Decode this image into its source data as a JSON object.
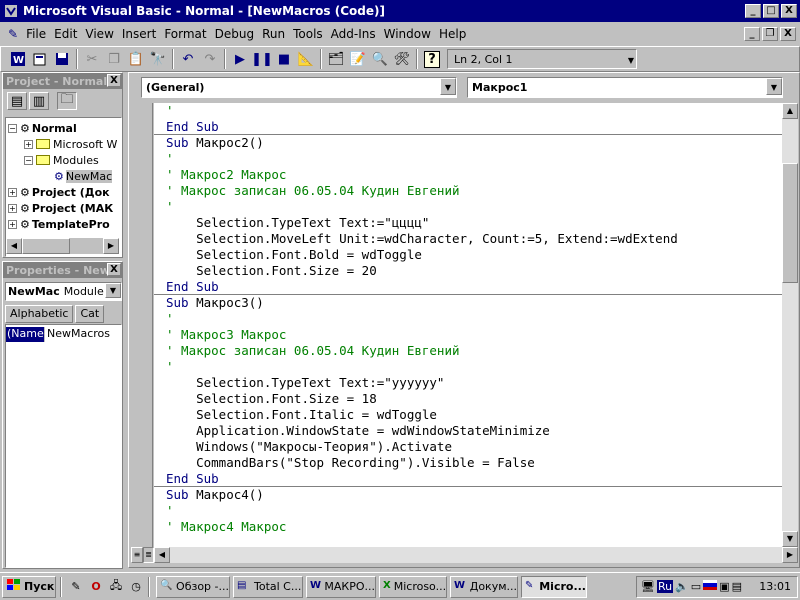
{
  "window": {
    "title": "Microsoft Visual Basic - Normal - [NewMacros (Code)]",
    "min": "_",
    "max": "□",
    "close": "X",
    "inner_min": "_",
    "inner_restore": "❐",
    "inner_close": "X"
  },
  "menu": [
    "File",
    "Edit",
    "View",
    "Insert",
    "Format",
    "Debug",
    "Run",
    "Tools",
    "Add-Ins",
    "Window",
    "Help"
  ],
  "toolbar": {
    "position": "Ln 2, Col 1"
  },
  "project": {
    "title": "Project - Normal",
    "close": "X",
    "tree": {
      "normal": "Normal",
      "microsoft": "Microsoft W",
      "modules": "Modules",
      "newmacros": "NewMac",
      "project1": "Project (Док",
      "project2": "Project (МАК",
      "template": "TemplatePro"
    }
  },
  "properties": {
    "title": "Properties - NewM",
    "close": "X",
    "object": "NewMac",
    "object_type": "Module",
    "tab_alpha": "Alphabetic",
    "tab_cat": "Cat",
    "row_name": "(Name)",
    "row_value": "NewMacros"
  },
  "code_window": {
    "object_combo": "(General)",
    "proc_combo": "Макрос1",
    "lines": [
      {
        "text": "'",
        "kind": "comment"
      },
      {
        "text": "End Sub",
        "kind": "keyword"
      },
      {
        "text": "Sub Макрос2()",
        "kind": "sub"
      },
      {
        "text": "'",
        "kind": "comment"
      },
      {
        "text": "' Макрос2 Макрос",
        "kind": "comment"
      },
      {
        "text": "' Макрос записан 06.05.04 Кудин Евгений",
        "kind": "comment"
      },
      {
        "text": "'",
        "kind": "comment"
      },
      {
        "text": "    Selection.TypeText Text:=\"цццц\"",
        "kind": "code"
      },
      {
        "text": "    Selection.MoveLeft Unit:=wdCharacter, Count:=5, Extend:=wdExtend",
        "kind": "code"
      },
      {
        "text": "    Selection.Font.Bold = wdToggle",
        "kind": "code"
      },
      {
        "text": "    Selection.Font.Size = 20",
        "kind": "code"
      },
      {
        "text": "End Sub",
        "kind": "keyword"
      },
      {
        "text": "Sub Макрос3()",
        "kind": "sub"
      },
      {
        "text": "'",
        "kind": "comment"
      },
      {
        "text": "' Макрос3 Макрос",
        "kind": "comment"
      },
      {
        "text": "' Макрос записан 06.05.04 Кудин Евгений",
        "kind": "comment"
      },
      {
        "text": "'",
        "kind": "comment"
      },
      {
        "text": "    Selection.TypeText Text:=\"уууууу\"",
        "kind": "code"
      },
      {
        "text": "    Selection.Font.Size = 18",
        "kind": "code"
      },
      {
        "text": "    Selection.Font.Italic = wdToggle",
        "kind": "code"
      },
      {
        "text": "    Application.WindowState = wdWindowStateMinimize",
        "kind": "code"
      },
      {
        "text": "    Windows(\"Макросы-Теория\").Activate",
        "kind": "code"
      },
      {
        "text": "    CommandBars(\"Stop Recording\").Visible = False",
        "kind": "code"
      },
      {
        "text": "End Sub",
        "kind": "keyword"
      },
      {
        "text": "Sub Макрос4()",
        "kind": "sub"
      },
      {
        "text": "'",
        "kind": "comment"
      },
      {
        "text": "' Макрос4 Макрос",
        "kind": "comment"
      }
    ]
  },
  "taskbar": {
    "start": "Пуск",
    "tasks": [
      {
        "label": "Обзор -...",
        "active": false
      },
      {
        "label": "Total C...",
        "active": false
      },
      {
        "label": "МАКРО...",
        "active": false
      },
      {
        "label": "Microso...",
        "active": false
      },
      {
        "label": "Докум...",
        "active": false
      },
      {
        "label": "Micro...",
        "active": true
      }
    ],
    "lang": "Ru",
    "clock": "13:01"
  },
  "colors": {
    "titlebar": "#000080",
    "comment": "#008000",
    "keyword": "#000080"
  }
}
